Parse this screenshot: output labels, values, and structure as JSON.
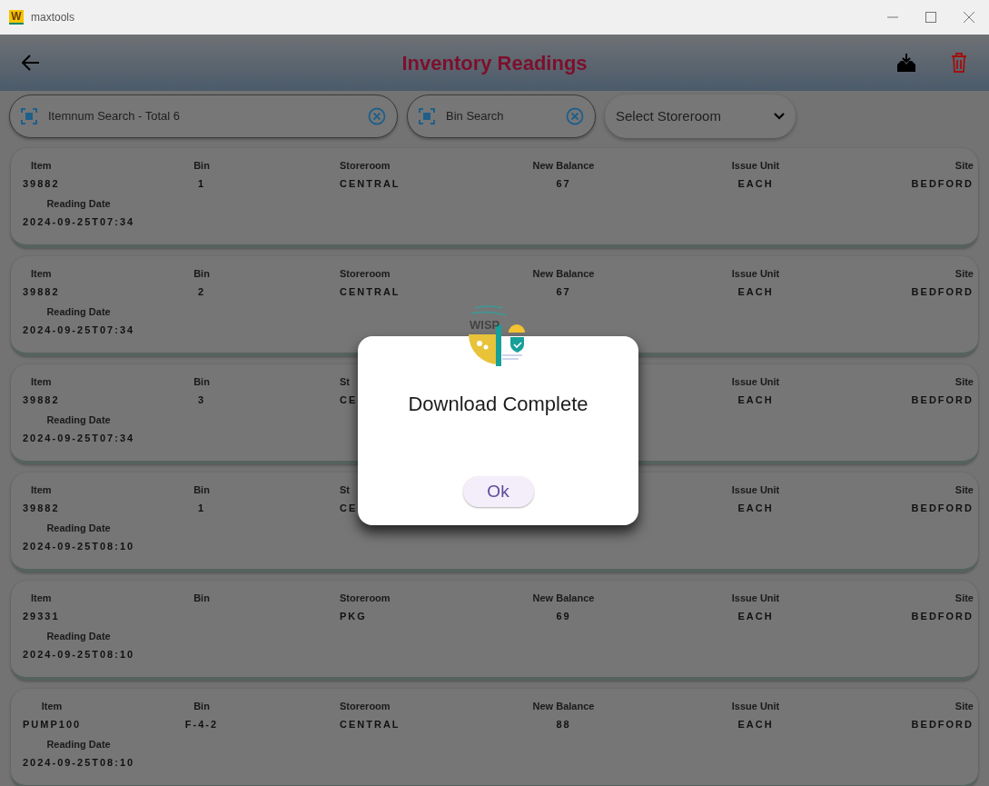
{
  "window": {
    "icon_letter": "W",
    "title": "maxtools"
  },
  "app_bar": {
    "title": "Inventory Readings"
  },
  "filters": {
    "item_search": {
      "placeholder": "Itemnum Search - Total 6"
    },
    "bin_search": {
      "placeholder": "Bin Search"
    },
    "storeroom_select": {
      "placeholder": "Select Storeroom"
    }
  },
  "rows": [
    {
      "item": {
        "label": "Item",
        "value": "39882"
      },
      "bin": {
        "label": "Bin",
        "value": "1"
      },
      "storeroom": {
        "label": "Storeroom",
        "value": "CENTRAL"
      },
      "new_balance": {
        "label": "New Balance",
        "value": "67"
      },
      "issue_unit": {
        "label": "Issue Unit",
        "value": "EACH"
      },
      "site": {
        "label": "Site",
        "value": "BEDFORD"
      },
      "reading_date": {
        "label": "Reading Date",
        "value": "2024-09-25T07:34"
      }
    },
    {
      "item": {
        "label": "Item",
        "value": "39882"
      },
      "bin": {
        "label": "Bin",
        "value": "2"
      },
      "storeroom": {
        "label": "Storeroom",
        "value": "CENTRAL"
      },
      "new_balance": {
        "label": "New Balance",
        "value": "67"
      },
      "issue_unit": {
        "label": "Issue Unit",
        "value": "EACH"
      },
      "site": {
        "label": "Site",
        "value": "BEDFORD"
      },
      "reading_date": {
        "label": "Reading Date",
        "value": "2024-09-25T07:34"
      }
    },
    {
      "item": {
        "label": "Item",
        "value": "39882"
      },
      "bin": {
        "label": "Bin",
        "value": "3"
      },
      "storeroom": {
        "label": "St",
        "value": "CE"
      },
      "issue_unit": {
        "label": "Issue Unit",
        "value": "EACH"
      },
      "site": {
        "label": "Site",
        "value": "BEDFORD"
      },
      "reading_date": {
        "label": "Reading Date",
        "value": "2024-09-25T07:34"
      }
    },
    {
      "item": {
        "label": "Item",
        "value": "39882"
      },
      "bin": {
        "label": "Bin",
        "value": "1"
      },
      "storeroom": {
        "label": "St",
        "value": "CE"
      },
      "issue_unit": {
        "label": "Issue Unit",
        "value": "EACH"
      },
      "site": {
        "label": "Site",
        "value": "BEDFORD"
      },
      "reading_date": {
        "label": "Reading Date",
        "value": "2024-09-25T08:10"
      }
    },
    {
      "item": {
        "label": "Item",
        "value": "29331"
      },
      "bin": {
        "label": "Bin"
      },
      "storeroom": {
        "label": "Storeroom",
        "value": "PKG"
      },
      "new_balance": {
        "label": "New Balance",
        "value": "69"
      },
      "issue_unit": {
        "label": "Issue Unit",
        "value": "EACH"
      },
      "site": {
        "label": "Site",
        "value": "BEDFORD"
      },
      "reading_date": {
        "label": "Reading Date",
        "value": "2024-09-25T08:10"
      }
    },
    {
      "item": {
        "label": "Item",
        "value": "PUMP100"
      },
      "bin": {
        "label": "Bin",
        "value": "F-4-2"
      },
      "storeroom": {
        "label": "Storeroom",
        "value": "CENTRAL"
      },
      "new_balance": {
        "label": "New Balance",
        "value": "88"
      },
      "issue_unit": {
        "label": "Issue Unit",
        "value": "EACH"
      },
      "site": {
        "label": "Site",
        "value": "BEDFORD"
      },
      "reading_date": {
        "label": "Reading Date",
        "value": "2024-09-25T08:10"
      }
    }
  ],
  "dialog": {
    "logo_text": "WISP",
    "message": "Download Complete",
    "button": "Ok"
  }
}
